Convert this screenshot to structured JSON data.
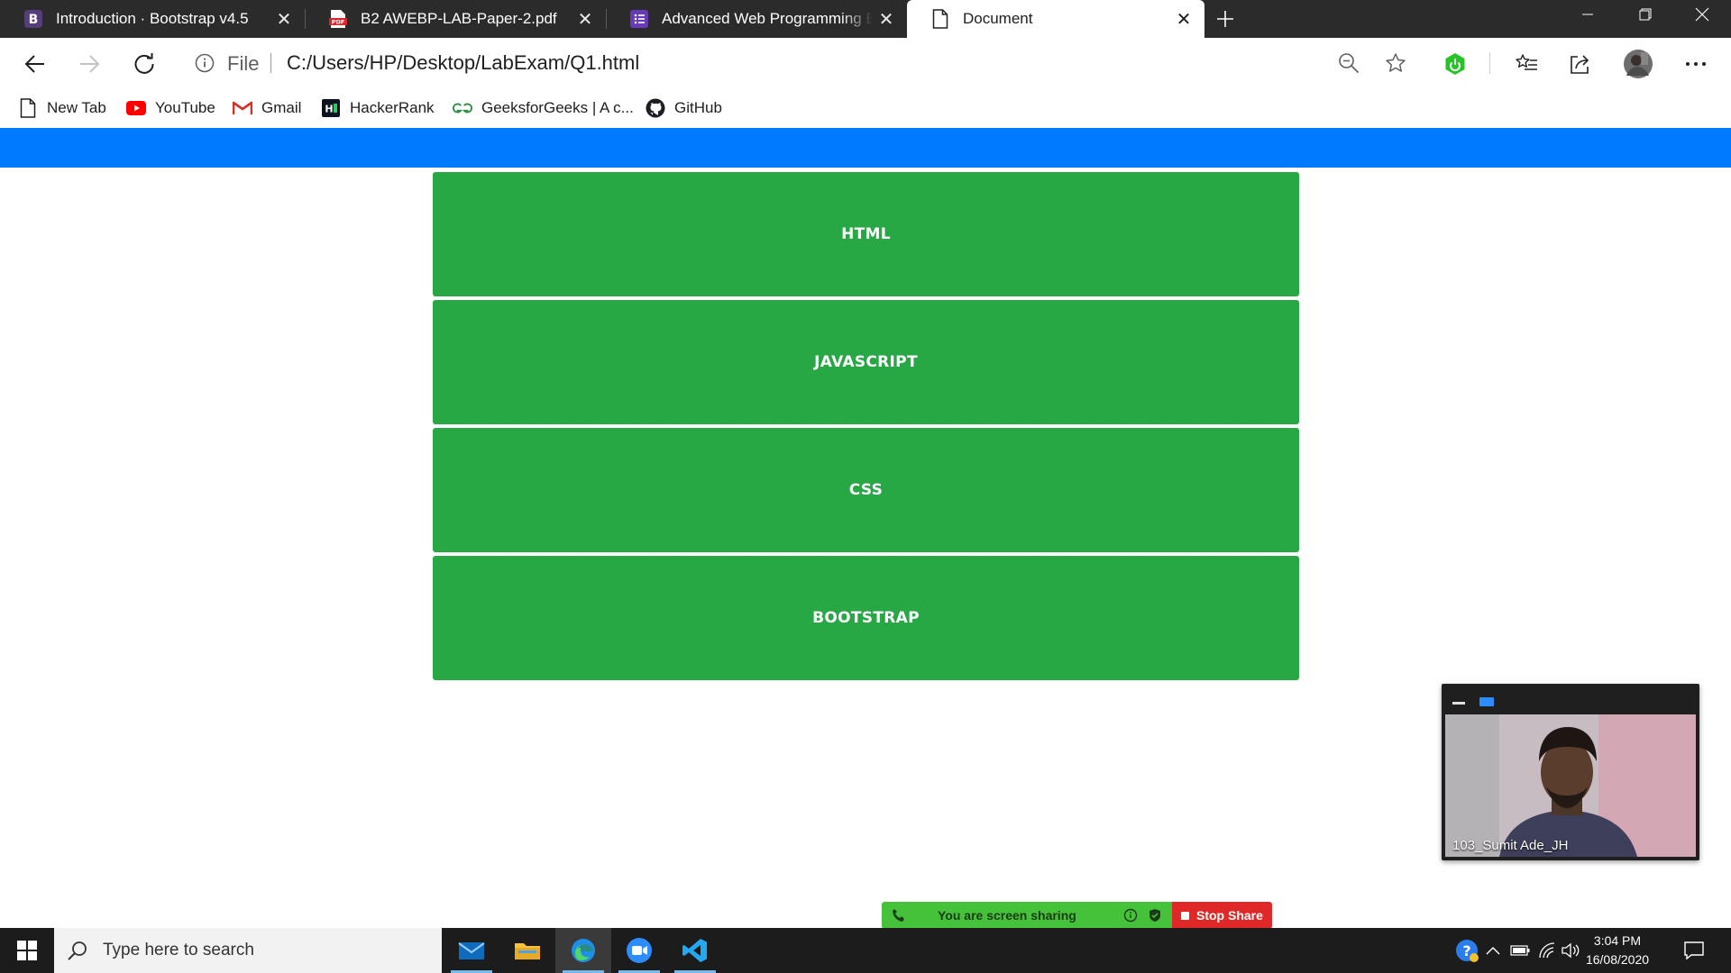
{
  "browser": {
    "tabs": [
      {
        "title": "Introduction · Bootstrap v4.5",
        "icon": "bootstrap-icon",
        "active": false
      },
      {
        "title": "B2 AWEBP-LAB-Paper-2.pdf",
        "icon": "pdf-icon",
        "active": false
      },
      {
        "title": "Advanced Web Programming Engineering",
        "icon": "forms-icon",
        "active": false
      },
      {
        "title": "Document",
        "icon": "page-icon",
        "active": true
      }
    ],
    "address": {
      "scheme": "File",
      "url": "C:/Users/HP/Desktop/LabExam/Q1.html"
    },
    "favorites": [
      {
        "label": "New Tab",
        "icon": "page-icon"
      },
      {
        "label": "YouTube",
        "icon": "youtube-icon"
      },
      {
        "label": "Gmail",
        "icon": "gmail-icon"
      },
      {
        "label": "HackerRank",
        "icon": "hackerrank-icon"
      },
      {
        "label": "GeeksforGeeks | A c...",
        "icon": "geeksforgeeks-icon"
      },
      {
        "label": "GitHub",
        "icon": "github-icon"
      }
    ]
  },
  "page": {
    "navbar_color": "#007bff",
    "card_color": "#28a745",
    "cards": [
      {
        "label": "HTML"
      },
      {
        "label": "JAVASCRIPT"
      },
      {
        "label": "CSS"
      },
      {
        "label": "BOOTSTRAP"
      }
    ]
  },
  "zoom": {
    "participant_name": "103_Sumit Ade_JH",
    "share_status": "You are screen sharing",
    "stop_label": "Stop Share"
  },
  "taskbar": {
    "search_placeholder": "Type here to search",
    "apps": [
      "mail-icon",
      "file-explorer-icon",
      "edge-icon",
      "zoom-icon",
      "vscode-icon"
    ],
    "time": "3:04 PM",
    "date": "16/08/2020"
  }
}
